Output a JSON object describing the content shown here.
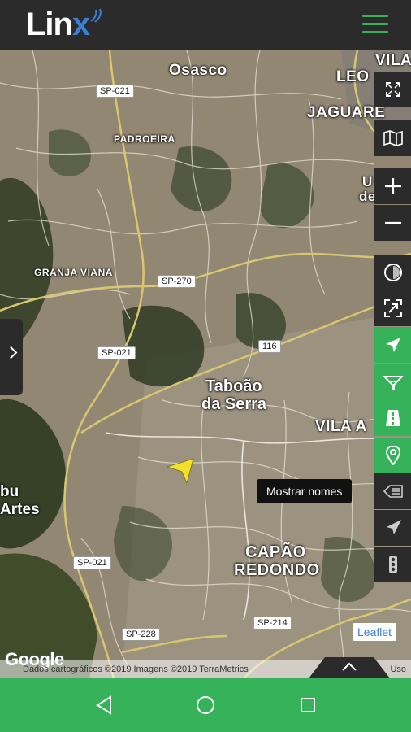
{
  "app": {
    "logo_text": "Lin",
    "logo_x": "x"
  },
  "map": {
    "places": {
      "osasco": "Osasco",
      "leo": "LEO",
      "vila_top": "VILA",
      "jaguare": "JAGUARE",
      "padroeira": "PADROEIRA",
      "granja_viana": "GRANJA VIANA",
      "taboao": "Taboão",
      "da_serra": "da Serra",
      "vila_a": "VILA A",
      "bu": "bu",
      "artes": "Artes",
      "capao": "CAPÃO",
      "redondo": "REDONDO",
      "u_partial": "U",
      "de_partial": "de"
    },
    "roads": {
      "sp021_top": "SP-021",
      "sp270": "SP-270",
      "sp021_mid": "SP-021",
      "r116": "116",
      "sp021_bottom": "SP-021",
      "sp228": "SP-228",
      "sp214": "SP-214"
    },
    "tooltip": "Mostrar nomes",
    "leaflet_label": "Leaflet",
    "google_label": "Google",
    "attribution": "Dados cartográficos ©2019 Imagens ©2019 TerraMetrics",
    "attribution_suffix": "Uso"
  },
  "controls": [
    {
      "name": "fullscreen-icon"
    },
    {
      "name": "map-layers-icon"
    },
    {
      "name": "zoom-in-icon"
    },
    {
      "name": "zoom-out-icon"
    },
    {
      "name": "compass-icon"
    },
    {
      "name": "fit-bounds-icon"
    },
    {
      "name": "navigate-arrow-icon"
    },
    {
      "name": "filter-icon"
    },
    {
      "name": "road-icon"
    },
    {
      "name": "location-pin-icon"
    },
    {
      "name": "show-names-icon"
    },
    {
      "name": "send-icon"
    },
    {
      "name": "traffic-light-icon"
    }
  ],
  "colors": {
    "accent": "#36b35a",
    "dark": "#2b2b2b",
    "link": "#3b7fd6",
    "marker": "#f1e12a"
  }
}
